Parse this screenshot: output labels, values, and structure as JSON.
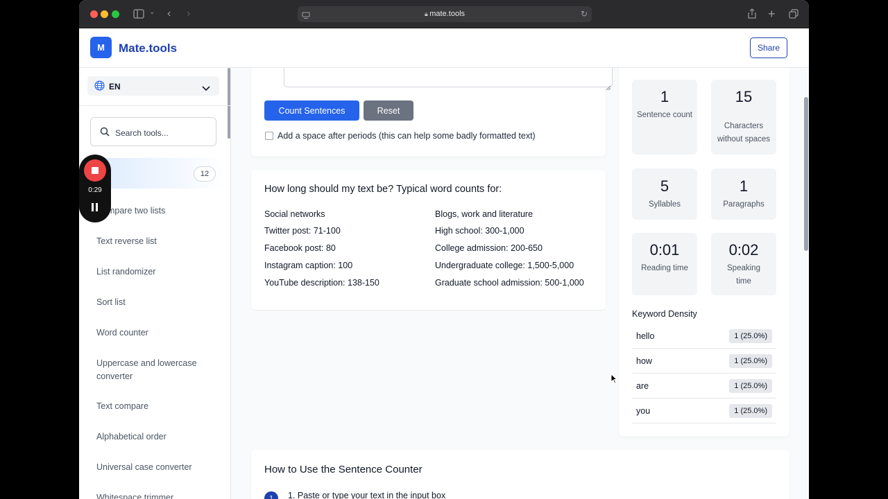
{
  "browser": {
    "url": "mate.tools"
  },
  "header": {
    "logo_letter": "M",
    "brand": "Mate.tools",
    "share_label": "Share"
  },
  "sidebar": {
    "language": "EN",
    "search_placeholder": "Search tools...",
    "active_badge": "12",
    "items": [
      "Compare two lists",
      "Text reverse list",
      "List randomizer",
      "Sort list",
      "Word counter",
      "Uppercase and lowercase converter",
      "Text compare",
      "Alphabetical order",
      "Universal case converter",
      "Whitespace trimmer"
    ]
  },
  "recorder": {
    "time": "0:29"
  },
  "form": {
    "count_button": "Count Sentences",
    "reset_button": "Reset",
    "checkbox_label": "Add a space after periods (this can help some badly formatted text)",
    "checkbox_checked": false
  },
  "word_counts": {
    "title": "How long should my text be? Typical word counts for:",
    "social_heading": "Social networks",
    "social": [
      "Twitter post: 71-100",
      "Facebook post: 80",
      "Instagram caption: 100",
      "YouTube description: 138-150"
    ],
    "blogs_heading": "Blogs, work and literature",
    "blogs": [
      "High school: 300-1,000",
      "College admission: 200-650",
      "Undergraduate college: 1,500-5,000",
      "Graduate school admission: 500-1,000"
    ]
  },
  "stats": [
    {
      "value": "1",
      "label": "Sentence count"
    },
    {
      "value": "15",
      "label": "Characters without spaces"
    },
    {
      "value": "5",
      "label": "Syllables"
    },
    {
      "value": "1",
      "label": "Paragraphs"
    },
    {
      "value": "0:01",
      "label": "Reading time"
    },
    {
      "value": "0:02",
      "label": "Speaking time"
    }
  ],
  "keyword_density": {
    "title": "Keyword Density",
    "rows": [
      {
        "word": "hello",
        "count": "1 (25.0%)"
      },
      {
        "word": "how",
        "count": "1 (25.0%)"
      },
      {
        "word": "are",
        "count": "1 (25.0%)"
      },
      {
        "word": "you",
        "count": "1 (25.0%)"
      }
    ]
  },
  "how_to": {
    "title": "How to Use the Sentence Counter",
    "step_number": "1",
    "step1": "1. Paste or type your text in the input box"
  }
}
